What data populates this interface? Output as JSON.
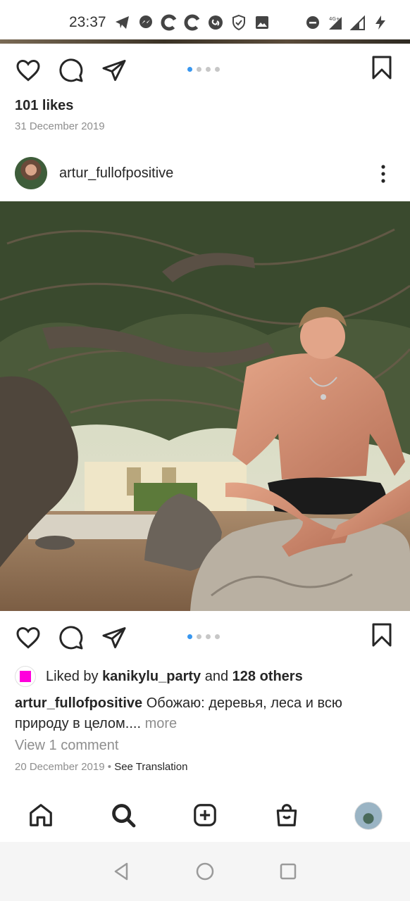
{
  "status_bar": {
    "time": "23:37",
    "left_icons": [
      "telegram-icon",
      "messenger-icon",
      "c-app-icon",
      "c-app-icon",
      "shazam-icon",
      "shield-icon",
      "gallery-icon"
    ],
    "right_icons": [
      "do-not-disturb-icon",
      "signal-4g-icon",
      "signal-r-icon",
      "charging-icon"
    ],
    "network_label": "4G+"
  },
  "previous_post": {
    "likes": "101 likes",
    "date": "31 December 2019",
    "carousel_dots": 4,
    "active_dot": 0
  },
  "post": {
    "username": "artur_fullofpositive",
    "carousel_dots": 4,
    "active_dot": 0,
    "liked_by_prefix": "Liked by",
    "liked_by_user": "kanikylu_party",
    "liked_by_and": "and",
    "liked_by_others": "128 others",
    "caption_user": "artur_fullofpositive",
    "caption_text": "Обожаю: деревья, леса и всю природу в целом.",
    "caption_ellipsis": "...",
    "caption_more": "more",
    "view_comments": "View 1 comment",
    "date": "20 December 2019",
    "separator": "•",
    "see_translation": "See Translation"
  },
  "bottom_nav": [
    "home-icon",
    "search-icon",
    "new-post-icon",
    "shop-icon",
    "profile-avatar"
  ],
  "colors": {
    "accent_dot": "#3897f0",
    "text": "#262626",
    "muted": "#8e8e8e",
    "liker_square": "#ff00dc"
  }
}
